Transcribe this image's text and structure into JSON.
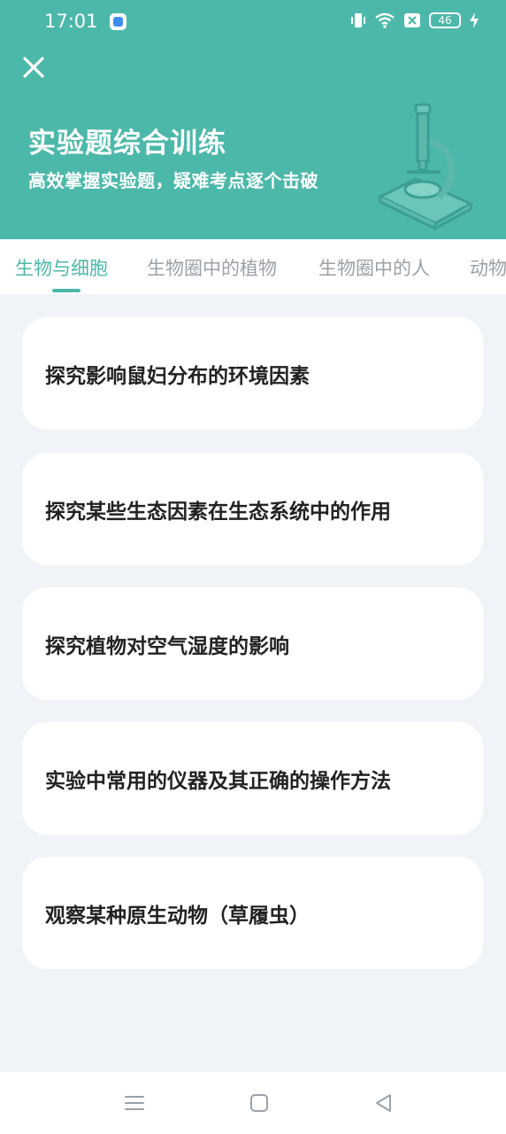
{
  "status_bar": {
    "time": "17:01",
    "battery": "46",
    "icons": [
      "app-notification-icon",
      "vibrate-icon",
      "wifi-icon",
      "sim-x-icon",
      "battery-icon",
      "charging-icon"
    ]
  },
  "header": {
    "title": "实验题综合训练",
    "subtitle": "高效掌握实验题，疑难考点逐个击破",
    "background": "#4cb8aa",
    "icons": [
      "close-icon",
      "microscope-icon"
    ]
  },
  "tabs": [
    {
      "label": "生物与细胞",
      "active": true
    },
    {
      "label": "生物圈中的植物",
      "active": false
    },
    {
      "label": "生物圈中的人",
      "active": false
    },
    {
      "label": "动物",
      "active": false
    }
  ],
  "accent_color": "#4cb8aa",
  "experiments": [
    {
      "label": "探究影响鼠妇分布的环境因素"
    },
    {
      "label": "探究某些生态因素在生态系统中的作用"
    },
    {
      "label": "探究植物对空气湿度的影响"
    },
    {
      "label": "实验中常用的仪器及其正确的操作方法"
    },
    {
      "label": "观察某种原生动物（草履虫）"
    }
  ],
  "nav_bar": {
    "icons": [
      "menu-icon",
      "home-icon",
      "back-icon"
    ]
  }
}
